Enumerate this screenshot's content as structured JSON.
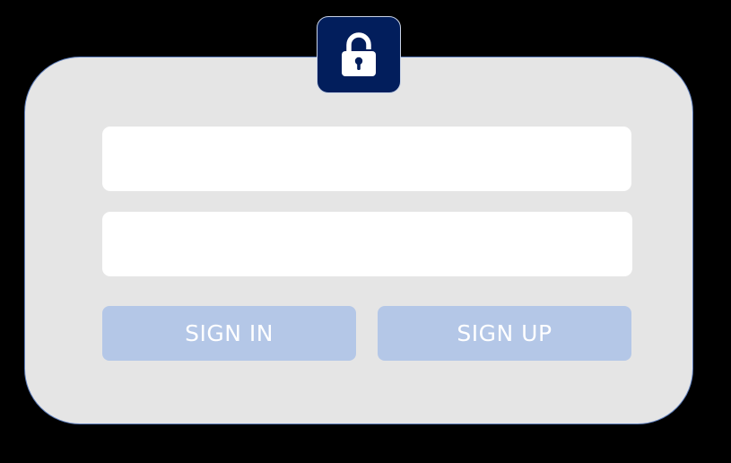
{
  "login_panel": {
    "lock_icon": "lock-icon",
    "username_field": {
      "value": "",
      "placeholder": ""
    },
    "password_field": {
      "value": "",
      "placeholder": ""
    },
    "sign_in_label": "SIGN IN",
    "sign_up_label": "SIGN UP"
  },
  "colors": {
    "background": "#000000",
    "panel": "#e5e5e5",
    "lock_badge": "#021e5c",
    "button": "#b4c7e7",
    "button_text": "#ffffff",
    "field": "#ffffff"
  }
}
